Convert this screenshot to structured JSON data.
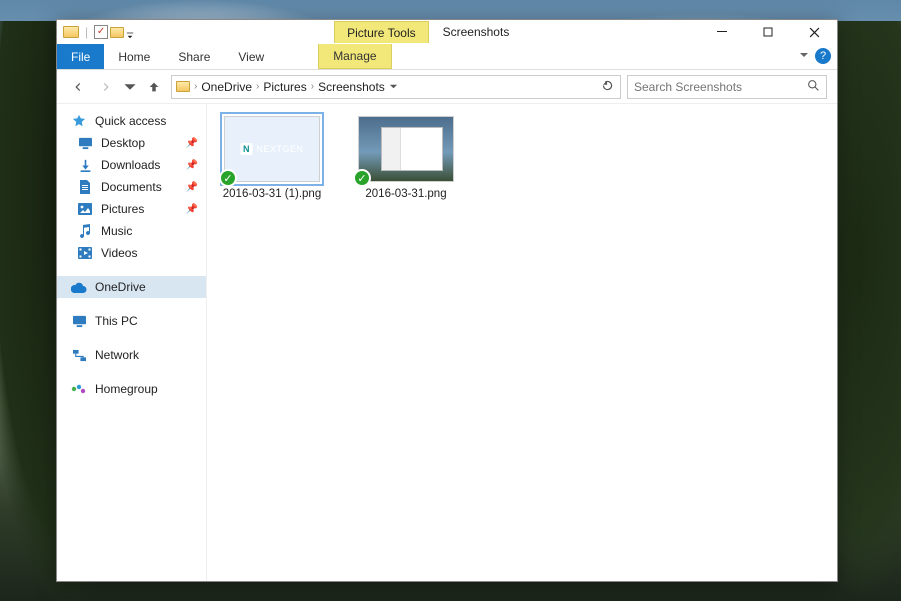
{
  "title": {
    "context_tab": "Picture Tools",
    "window": "Screenshots"
  },
  "ribbon": {
    "file": "File",
    "home": "Home",
    "share": "Share",
    "view": "View",
    "manage": "Manage",
    "help_tip": "?"
  },
  "nav": {
    "breadcrumb": [
      "OneDrive",
      "Pictures",
      "Screenshots"
    ],
    "search_placeholder": "Search Screenshots"
  },
  "sidebar": {
    "quick_access": "Quick access",
    "desktop": "Desktop",
    "downloads": "Downloads",
    "documents": "Documents",
    "pictures": "Pictures",
    "music": "Music",
    "videos": "Videos",
    "onedrive": "OneDrive",
    "this_pc": "This PC",
    "network": "Network",
    "homegroup": "Homegroup"
  },
  "files": [
    {
      "name": "2016-03-31 (1).png",
      "selected": true,
      "kind": "teal"
    },
    {
      "name": "2016-03-31.png",
      "selected": false,
      "kind": "shot"
    }
  ]
}
